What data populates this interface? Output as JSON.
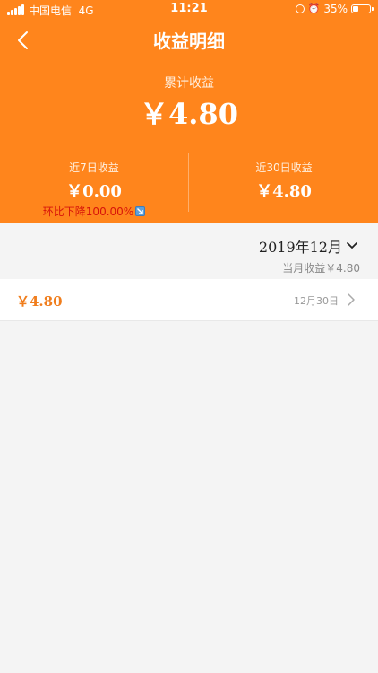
{
  "status_bar": {
    "carrier": "中国电信",
    "network": "4G",
    "time": "11:21",
    "battery_percent": "35%",
    "battery_level": 0.35
  },
  "nav": {
    "title": "收益明细",
    "back_icon": "chevron-left-icon"
  },
  "summary": {
    "total_label": "累计收益",
    "total_value": "￥4.80",
    "last7": {
      "label": "近7日收益",
      "value": "￥0.00",
      "change": "环比下降100.00%"
    },
    "last30": {
      "label": "近30日收益",
      "value": "￥4.80"
    }
  },
  "month": {
    "selected": "2019年12月",
    "total": "当月收益￥4.80"
  },
  "records": [
    {
      "amount": "￥4.80",
      "date": "12月30日"
    }
  ],
  "colors": {
    "header_bg": "#ff851c",
    "amount_orange": "#f07d1c",
    "decrease_red": "#d7140a"
  }
}
